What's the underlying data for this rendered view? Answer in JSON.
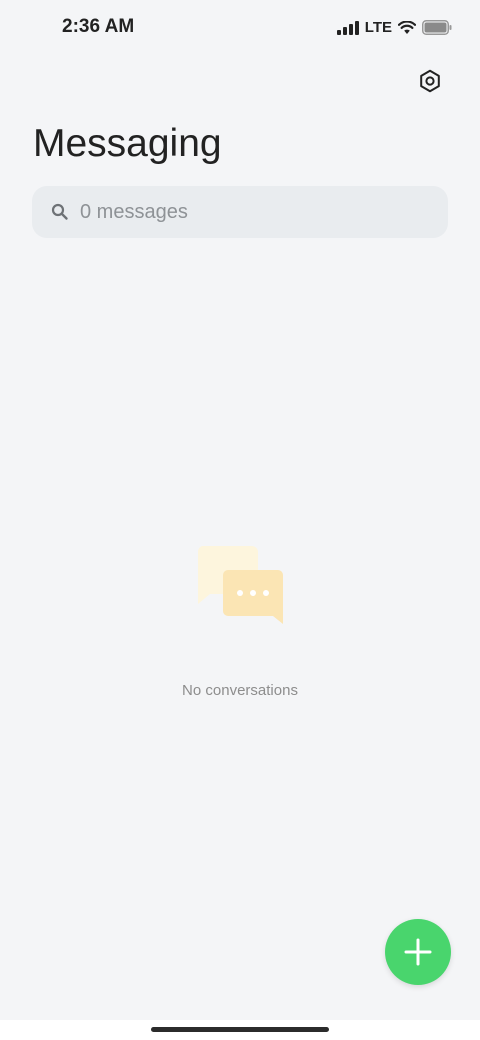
{
  "status_bar": {
    "time": "2:36 AM",
    "network": "LTE",
    "icons": [
      "signal-icon",
      "wifi-icon",
      "battery-icon"
    ]
  },
  "header": {
    "title": "Messaging",
    "settings_icon": "settings-icon"
  },
  "search": {
    "placeholder": "0 messages",
    "icon": "search-icon"
  },
  "empty_state": {
    "illustration": "chat-bubbles-icon",
    "text": "No conversations"
  },
  "fab": {
    "icon": "plus-icon",
    "color": "#49d56d"
  },
  "colors": {
    "background": "#f4f5f7",
    "search_background": "#e9ecef",
    "accent": "#49d56d"
  }
}
